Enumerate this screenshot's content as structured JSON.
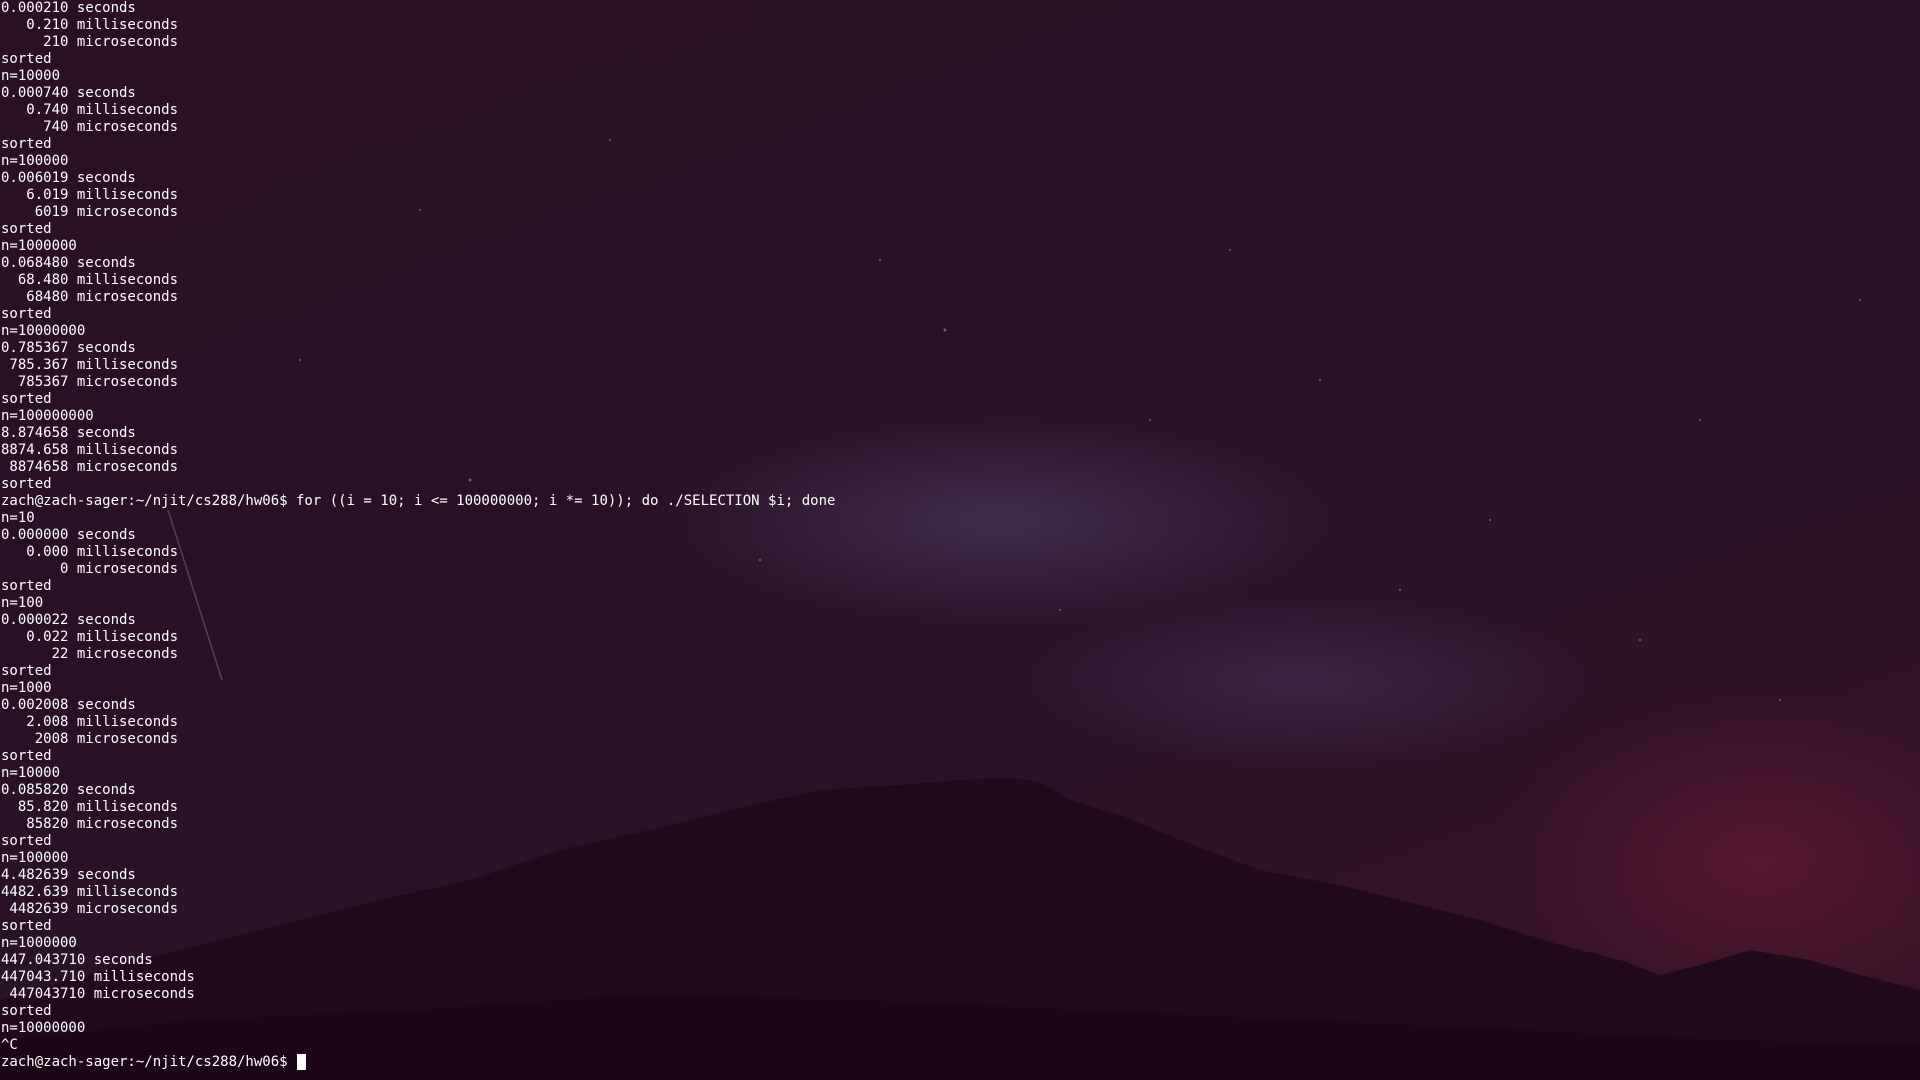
{
  "colors": {
    "background": "#2a1026",
    "text": "#ffffff",
    "mountain": "#23091c",
    "accent_glow": "#7d1e3c"
  },
  "terminal": {
    "lines": [
      "0.000210 seconds",
      "   0.210 milliseconds",
      "     210 microseconds",
      "sorted",
      "n=10000",
      "0.000740 seconds",
      "   0.740 milliseconds",
      "     740 microseconds",
      "sorted",
      "n=100000",
      "0.006019 seconds",
      "   6.019 milliseconds",
      "    6019 microseconds",
      "sorted",
      "n=1000000",
      "0.068480 seconds",
      "  68.480 milliseconds",
      "   68480 microseconds",
      "sorted",
      "n=10000000",
      "0.785367 seconds",
      " 785.367 milliseconds",
      "  785367 microseconds",
      "sorted",
      "n=100000000",
      "8.874658 seconds",
      "8874.658 milliseconds",
      " 8874658 microseconds",
      "sorted",
      "zach@zach-sager:~/njit/cs288/hw06$ for ((i = 10; i <= 100000000; i *= 10)); do ./SELECTION $i; done",
      "n=10",
      "0.000000 seconds",
      "   0.000 milliseconds",
      "       0 microseconds",
      "sorted",
      "n=100",
      "0.000022 seconds",
      "   0.022 milliseconds",
      "      22 microseconds",
      "sorted",
      "n=1000",
      "0.002008 seconds",
      "   2.008 milliseconds",
      "    2008 microseconds",
      "sorted",
      "n=10000",
      "0.085820 seconds",
      "  85.820 milliseconds",
      "   85820 microseconds",
      "sorted",
      "n=100000",
      "4.482639 seconds",
      "4482.639 milliseconds",
      " 4482639 microseconds",
      "sorted",
      "n=1000000",
      "447.043710 seconds",
      "447043.710 milliseconds",
      " 447043710 microseconds",
      "sorted",
      "n=10000000",
      "^C"
    ],
    "prompt": "zach@zach-sager:~/njit/cs288/hw06$ "
  }
}
